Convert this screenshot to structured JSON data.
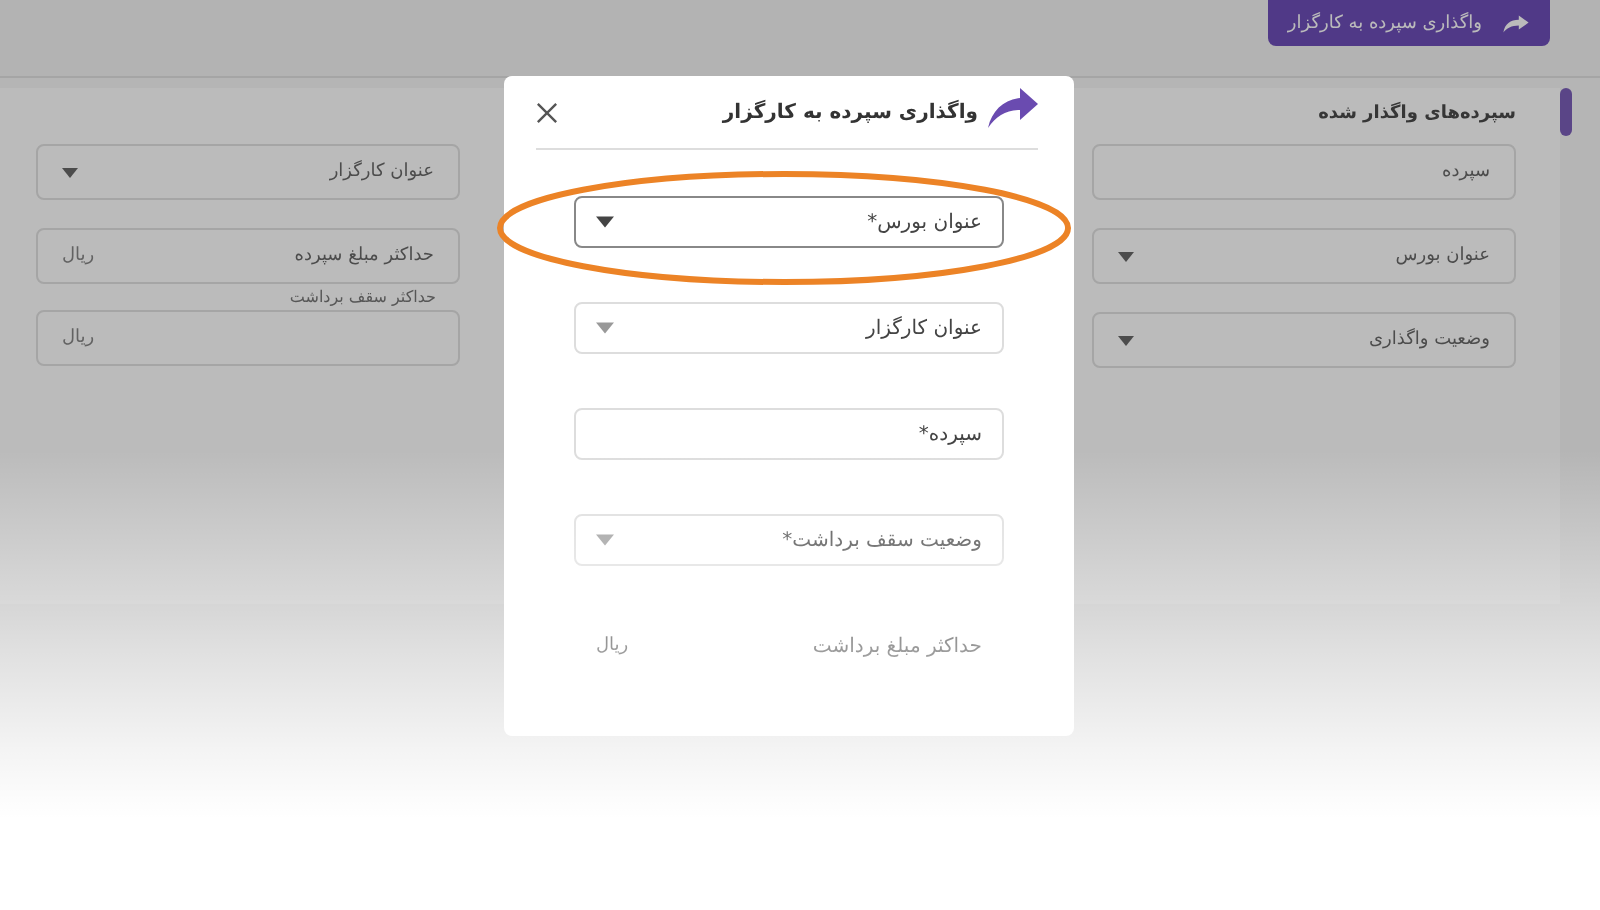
{
  "header": {
    "button": "واگذاری سپرده به کارگزار"
  },
  "panel": {
    "title": "سپرده‌های واگذار شده",
    "right_fields": [
      {
        "label": "سپرده",
        "kind": "text"
      },
      {
        "label": "عنوان بورس",
        "kind": "select"
      },
      {
        "label": "وضعیت واگذاری",
        "kind": "select"
      }
    ],
    "left_fields": [
      {
        "label": "عنوان کارگزار",
        "kind": "select"
      },
      {
        "label": "حداکثر مبلغ سپرده",
        "kind": "amount",
        "unit": "ریال"
      },
      {
        "caption": "حداکثر سقف برداشت",
        "kind": "amount",
        "unit": "ریال"
      }
    ]
  },
  "dialog": {
    "title": "واگذاری سپرده به کارگزار",
    "fields": [
      {
        "label": "عنوان بورس*",
        "kind": "select",
        "highlighted": true
      },
      {
        "label": "عنوان کارگزار",
        "kind": "select",
        "highlighted": false
      },
      {
        "label": "سپرده*",
        "kind": "text",
        "highlighted": false
      },
      {
        "label": "وضعیت سقف برداشت*",
        "kind": "select",
        "highlighted": false
      },
      {
        "label": "حداکثر مبلغ برداشت",
        "kind": "amount",
        "unit": "ریال",
        "highlighted": false
      }
    ]
  }
}
